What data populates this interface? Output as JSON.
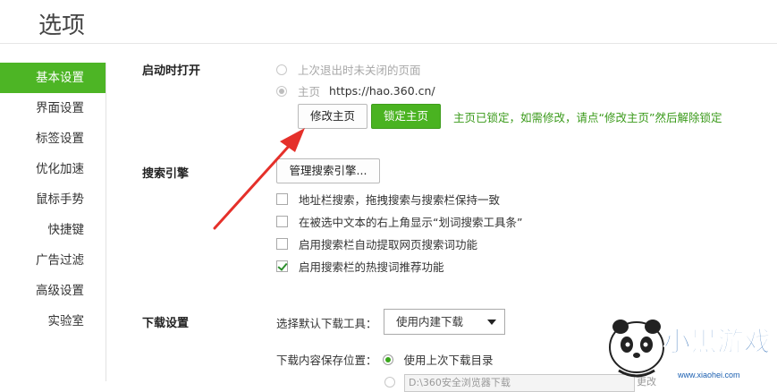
{
  "page_title": "选项",
  "sidebar": {
    "items": [
      {
        "label": "基本设置",
        "active": true
      },
      {
        "label": "界面设置"
      },
      {
        "label": "标签设置"
      },
      {
        "label": "优化加速"
      },
      {
        "label": "鼠标手势"
      },
      {
        "label": "快捷键"
      },
      {
        "label": "广告过滤"
      },
      {
        "label": "高级设置"
      },
      {
        "label": "实验室"
      }
    ]
  },
  "startup": {
    "label": "启动时打开",
    "opt_last": "上次退出时未关闭的页面",
    "opt_home": "主页",
    "home_url": "https://hao.360.cn/",
    "modify_btn": "修改主页",
    "lock_btn": "锁定主页",
    "lock_hint": "主页已锁定，如需修改，请点“修改主页”然后解除锁定"
  },
  "search": {
    "label": "搜索引擎",
    "manage_btn": "管理搜索引擎...",
    "options": [
      {
        "label": "地址栏搜索，拖拽搜索与搜索栏保持一致",
        "checked": false
      },
      {
        "label": "在被选中文本的右上角显示“划词搜索工具条”",
        "checked": false
      },
      {
        "label": "启用搜索栏自动提取网页搜索词功能",
        "checked": false
      },
      {
        "label": "启用搜索栏的热搜词推荐功能",
        "checked": true
      }
    ]
  },
  "download": {
    "label": "下载设置",
    "tool_label": "选择默认下载工具：",
    "tool_value": "使用内建下载",
    "location_label": "下载内容保存位置：",
    "location_opt": "使用上次下载目录",
    "path_value": "D:\\360安全浏览器下载",
    "browse_btn": "更改"
  },
  "watermark": {
    "brand": "小黑游戏",
    "site": "www.xiaohei.com"
  },
  "colors": {
    "accent": "#4db525",
    "arrow": "#e5302a",
    "hint": "#3a9a1a"
  }
}
